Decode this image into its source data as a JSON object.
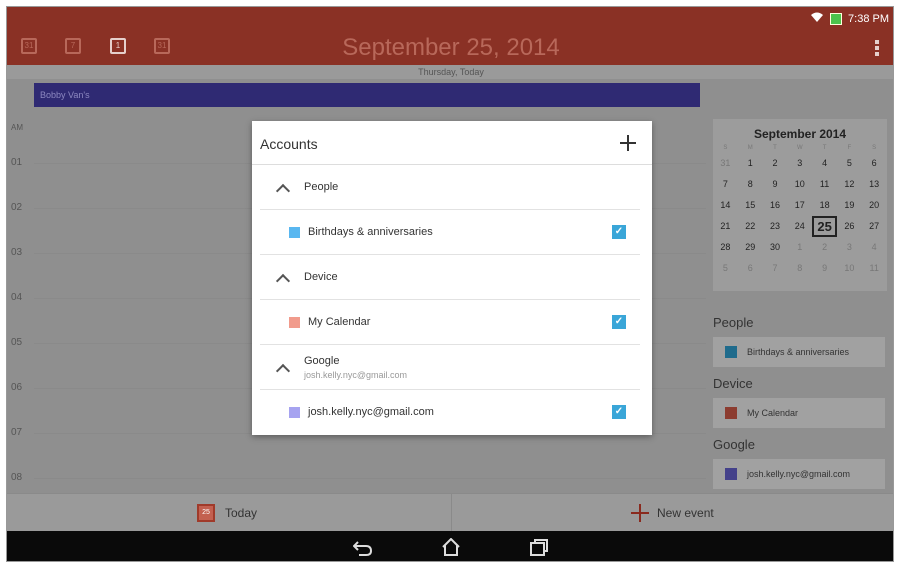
{
  "status_bar": {
    "time": "7:38 PM"
  },
  "header": {
    "title": "September 25, 2014",
    "views": [
      "31",
      "7",
      "1",
      "31"
    ]
  },
  "day_bar": {
    "label": "Thursday, Today"
  },
  "day_view": {
    "ampm": "AM",
    "all_day_event": "Bobby Van's",
    "hours": [
      "01",
      "02",
      "03",
      "04",
      "05",
      "06",
      "07",
      "08"
    ]
  },
  "mini_calendar": {
    "title": "September 2014",
    "dow": [
      "S",
      "M",
      "T",
      "W",
      "T",
      "F",
      "S"
    ],
    "weeks": [
      [
        "31",
        "1",
        "2",
        "3",
        "4",
        "5",
        "6"
      ],
      [
        "7",
        "8",
        "9",
        "10",
        "11",
        "12",
        "13"
      ],
      [
        "14",
        "15",
        "16",
        "17",
        "18",
        "19",
        "20"
      ],
      [
        "21",
        "22",
        "23",
        "24",
        "25",
        "26",
        "27"
      ],
      [
        "28",
        "29",
        "30",
        "1",
        "2",
        "3",
        "4"
      ],
      [
        "5",
        "6",
        "7",
        "8",
        "9",
        "10",
        "11"
      ]
    ],
    "today": "25"
  },
  "side_panel": {
    "groups": [
      {
        "label": "People",
        "item": "Birthdays & anniversaries",
        "color": "#1f6b8c"
      },
      {
        "label": "Device",
        "item": "My Calendar",
        "color": "#8c3c30"
      },
      {
        "label": "Google",
        "item": "josh.kelly.nyc@gmail.com",
        "color": "#44418a"
      }
    ]
  },
  "action_bar": {
    "today_label": "Today",
    "today_icon_text": "25",
    "new_event_label": "New event"
  },
  "dialog": {
    "title": "Accounts",
    "groups": [
      {
        "label": "People",
        "calendar": "Birthdays & anniversaries",
        "color": "#59b7f0",
        "checked": true
      },
      {
        "label": "Device",
        "calendar": "My Calendar",
        "color": "#f19b8c",
        "checked": true
      },
      {
        "label": "Google",
        "sublabel": "josh.kelly.nyc@gmail.com",
        "calendar": "josh.kelly.nyc@gmail.com",
        "color": "#a6a3f0",
        "checked": true
      }
    ]
  },
  "colors": {
    "header": "#8a3125",
    "checkbox": "#3aa6d8",
    "event": "#2f2a73"
  },
  "icons": {
    "wifi": "wifi-icon",
    "battery": "battery-icon",
    "back": "back-icon",
    "home": "home-icon",
    "recents": "recents-icon"
  }
}
